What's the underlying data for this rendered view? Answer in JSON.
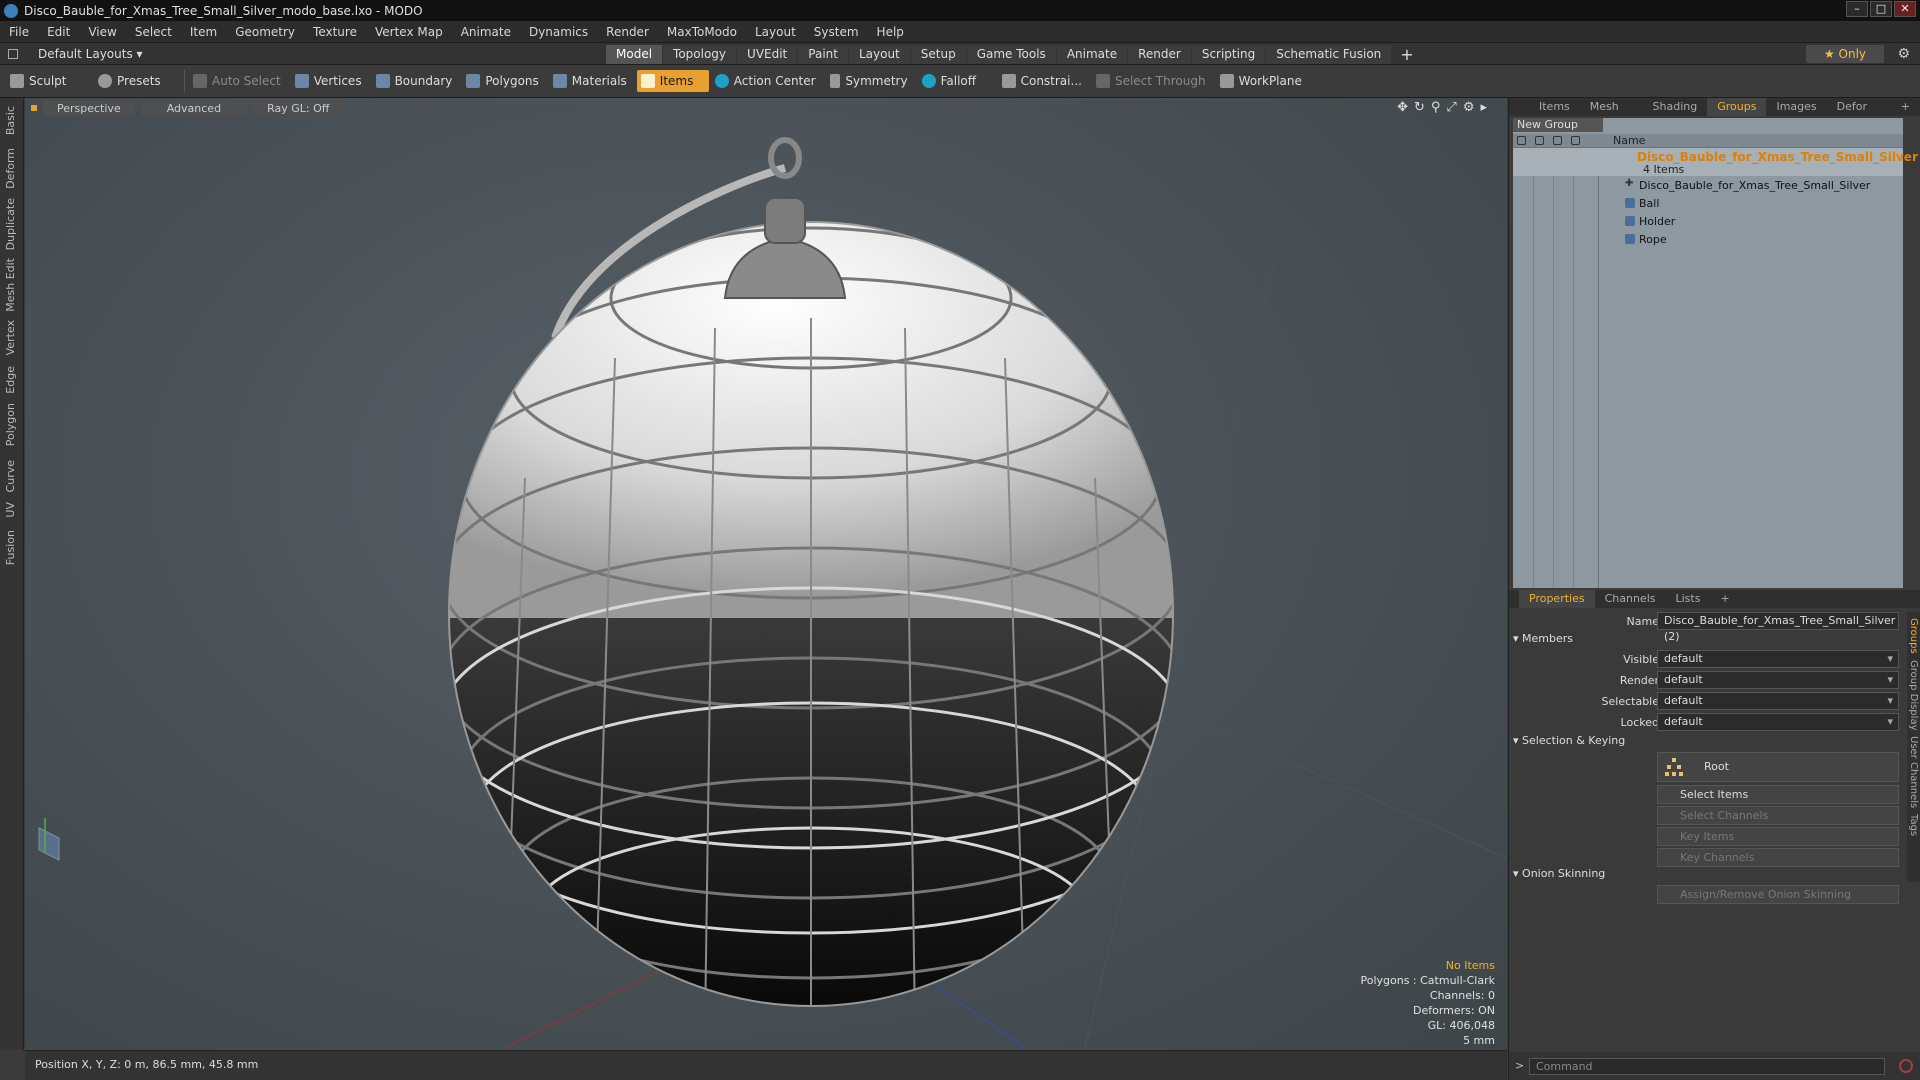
{
  "window": {
    "title": "Disco_Bauble_for_Xmas_Tree_Small_Silver_modo_base.lxo - MODO"
  },
  "menu": [
    "File",
    "Edit",
    "View",
    "Select",
    "Item",
    "Geometry",
    "Texture",
    "Vertex Map",
    "Animate",
    "Dynamics",
    "Render",
    "MaxToModo",
    "Layout",
    "System",
    "Help"
  ],
  "layoutbar": {
    "layout_dropdown": "Default Layouts ▾",
    "tabs": [
      "Model",
      "Topology",
      "UVEdit",
      "Paint",
      "Layout",
      "Setup",
      "Game Tools",
      "Animate",
      "Render",
      "Scripting",
      "Schematic Fusion"
    ],
    "active_tab": "Model",
    "only_label": "★  Only"
  },
  "toolbar": {
    "sculpt": "Sculpt",
    "presets": "Presets",
    "auto_select": "Auto Select",
    "vertices": "Vertices",
    "boundary": "Boundary",
    "polygons": "Polygons",
    "materials": "Materials",
    "items": "Items",
    "action_center": "Action Center",
    "symmetry": "Symmetry",
    "falloff": "Falloff",
    "constraints": "Constrai...",
    "select_through": "Select Through",
    "workplane": "WorkPlane"
  },
  "left_tabs": [
    "Basic",
    "Deform",
    "Duplicate",
    "Mesh Edit",
    "Vertex",
    "Edge",
    "Polygon",
    "Curve",
    "UV",
    "Fusion"
  ],
  "viewport": {
    "view_mode": "Perspective",
    "shading": "Advanced",
    "raygl": "Ray GL: Off",
    "info": {
      "no_items": "No Items",
      "polygons": "Polygons : Catmull-Clark",
      "channels": "Channels: 0",
      "deformers": "Deformers: ON",
      "gl": "GL: 406,048",
      "scale": "5 mm"
    }
  },
  "status": {
    "position": "Position X, Y, Z:  0 m, 86.5 mm, 45.8 mm"
  },
  "groups_panel": {
    "tabs": [
      "Items",
      "Mesh ...",
      "Shading",
      "Groups",
      "Images",
      "Defor ..."
    ],
    "active_tab": "Groups",
    "new_group": "New Group",
    "name_header": "Name",
    "group_name": "Disco_Bauble_for_Xmas_Tree_Small_Silver",
    "group_count": "4 Items",
    "children": [
      "Disco_Bauble_for_Xmas_Tree_Small_Silver",
      "Ball",
      "Holder",
      "Rope"
    ]
  },
  "properties": {
    "tabs": [
      "Properties",
      "Channels",
      "Lists"
    ],
    "active_tab": "Properties",
    "name_label": "Name",
    "name_value": "Disco_Bauble_for_Xmas_Tree_Small_Silver (2)",
    "members_section": "Members",
    "visible_label": "Visible",
    "visible_value": "default",
    "render_label": "Render",
    "render_value": "default",
    "selectable_label": "Selectable",
    "selectable_value": "default",
    "locked_label": "Locked",
    "locked_value": "default",
    "selection_section": "Selection & Keying",
    "root_button": "Root",
    "select_items": "Select Items",
    "select_channels": "Select Channels",
    "key_items": "Key Items",
    "key_channels": "Key Channels",
    "onion_section": "Onion Skinning",
    "onion_button": "Assign/Remove Onion Skinning",
    "side_tabs": [
      "Groups",
      "Group Display",
      "User Channels",
      "Tags"
    ]
  },
  "command": {
    "placeholder": "Command"
  },
  "colors": {
    "accent": "#e8a030",
    "group_name": "#e08000",
    "background": "#3a3a3a"
  }
}
